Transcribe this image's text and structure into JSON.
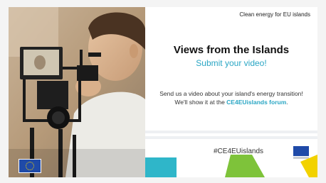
{
  "header": {
    "kicker": "Clean energy for EU islands"
  },
  "main": {
    "title": "Views from the Islands",
    "subtitle": "Submit your video!",
    "body_line1": "Send us a video about your island's energy transition!",
    "body_line2_prefix": "We'll show it at the ",
    "body_line2_highlight": "CE4EUislands forum",
    "body_line2_suffix": "."
  },
  "footer": {
    "hashtag": "#CE4EUislands"
  },
  "colors": {
    "accent": "#2aa6c4",
    "teal": "#2fb6c9",
    "green": "#7ec33a",
    "yellow": "#f2d200",
    "eu_blue": "#1f4aa8"
  },
  "icons": {
    "photo": "person-filming-with-camera-photo",
    "eu_flag": "eu-flag-icon"
  }
}
